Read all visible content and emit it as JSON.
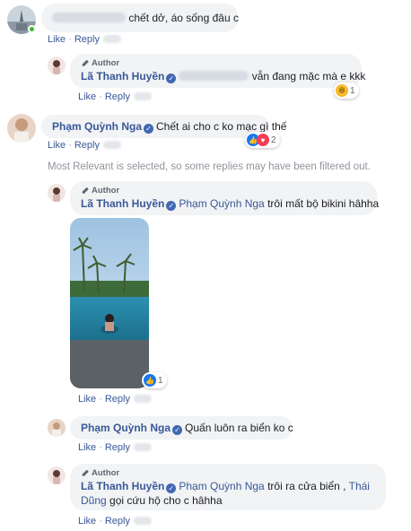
{
  "c1": {
    "text": "chết dở, áo sống đâu c",
    "like": "Like",
    "reply": "Reply"
  },
  "c2": {
    "author_badge": "Author",
    "name": "Lã Thanh Huyền",
    "text": "vẫn đang mặc mà e kkk",
    "like": "Like",
    "reply": "Reply",
    "reaction_count": "1"
  },
  "c3": {
    "name": "Phạm Quỳnh Nga",
    "text": "Chết ai cho c ko mạc gì thế",
    "like": "Like",
    "reply": "Reply",
    "reaction_count": "2"
  },
  "filter_notice": "Most Relevant is selected, so some replies may have been filtered out.",
  "c4": {
    "author_badge": "Author",
    "name": "Lã Thanh Huyền",
    "tag": "Phạm Quỳnh Nga",
    "text": "trôi mất bộ bikini hâhha",
    "like": "Like",
    "reply": "Reply",
    "reaction_count": "1"
  },
  "c5": {
    "name": "Phạm Quỳnh Nga",
    "text": "Quấn luôn ra biển ko c",
    "like": "Like",
    "reply": "Reply"
  },
  "c6": {
    "author_badge": "Author",
    "name": "Lã Thanh Huyền",
    "tag": "Phạm Quỳnh Nga",
    "text_a": "trôi ra cửa biển ,",
    "tag2": "Thái",
    "tag2b": "Dũng",
    "text_b": "gọi cứu hộ cho c hâhha",
    "like": "Like",
    "reply": "Reply"
  },
  "colors": {
    "link": "#385898",
    "bubble": "#f2f3f5",
    "like_blue": "#1877f2",
    "muted": "#90949c"
  }
}
